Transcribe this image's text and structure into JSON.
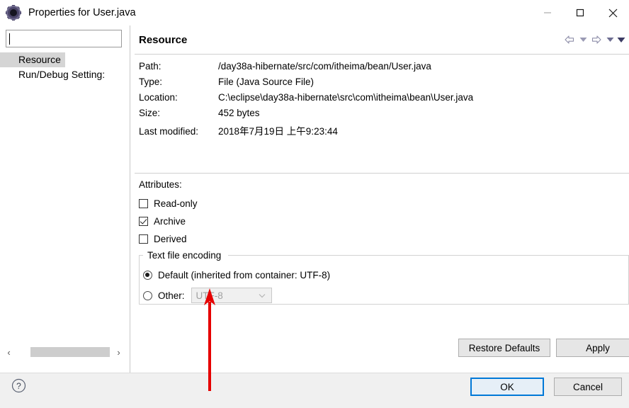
{
  "window": {
    "title": "Properties for User.java",
    "icon": "properties-gear-icon",
    "controls": {
      "minimize": "minimize-icon",
      "maximize": "maximize-icon",
      "close": "close-icon"
    }
  },
  "sidebar": {
    "filter": {
      "value": "",
      "placeholder": ""
    },
    "items": [
      {
        "label": "Resource",
        "selected": true
      },
      {
        "label": "Run/Debug Setting:",
        "selected": false
      }
    ],
    "scrollbar": {
      "left_arrow": "‹",
      "right_arrow": "›"
    }
  },
  "page": {
    "title": "Resource",
    "nav": {
      "back": "back-arrow-icon",
      "back_menu": "chevron-down-icon",
      "forward": "forward-arrow-icon",
      "forward_menu": "chevron-down-icon",
      "view_menu": "chevron-down-icon"
    },
    "properties": [
      {
        "label": "Path:",
        "value": "/day38a-hibernate/src/com/itheima/bean/User.java"
      },
      {
        "label": "Type:",
        "value": "File  (Java Source File)"
      },
      {
        "label": "Location:",
        "value": "C:\\eclipse\\day38a-hibernate\\src\\com\\itheima\\bean\\User.java"
      },
      {
        "label": "Size:",
        "value": "452  bytes"
      },
      {
        "label": "Last modified:",
        "value": "2018年7月19日 上午9:23:44"
      }
    ],
    "attributes": {
      "title": "Attributes:",
      "checkboxes": [
        {
          "label": "Read-only",
          "checked": false
        },
        {
          "label": "Archive",
          "checked": true
        },
        {
          "label": "Derived",
          "checked": false
        }
      ]
    },
    "encoding": {
      "legend": "Text file encoding",
      "default_option": "Default (inherited from container: UTF-8)",
      "default_selected": true,
      "other_option": "Other:",
      "other_selected": false,
      "combo_value": "UTF-8",
      "combo_enabled": false
    },
    "buttons": {
      "restore_defaults": "Restore Defaults",
      "apply": "Apply"
    }
  },
  "footer": {
    "help": "help-icon",
    "ok": "OK",
    "cancel": "Cancel"
  },
  "annotation": {
    "arrow_color": "#e60000",
    "points_to": "Other: encoding combo"
  }
}
